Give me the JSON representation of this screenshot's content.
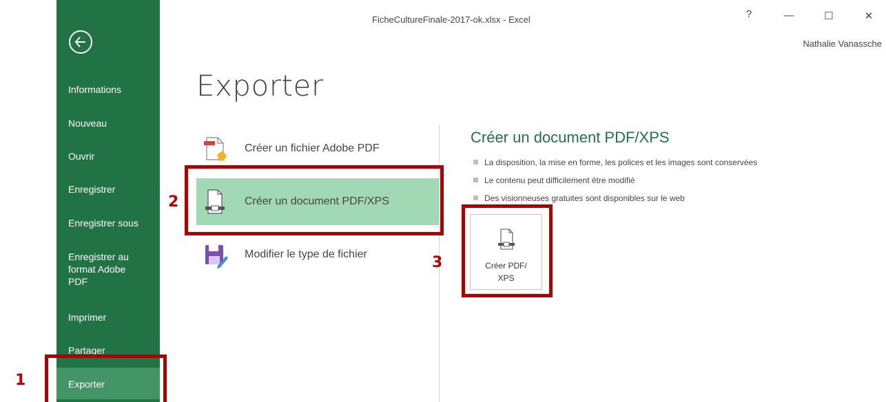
{
  "window": {
    "title": "FicheCultureFinale-2017-ok.xlsx - Excel",
    "user": "Nathalie Vanassche",
    "help_label": "?",
    "minimize_label": "—",
    "maximize_label": "☐",
    "close_label": "✕"
  },
  "sidebar": {
    "back_icon": "back-arrow-circle-icon",
    "items": [
      {
        "label": "Informations"
      },
      {
        "label": "Nouveau"
      },
      {
        "label": "Ouvrir"
      },
      {
        "label": "Enregistrer"
      },
      {
        "label": "Enregistrer sous"
      },
      {
        "label": "Enregistrer au format Adobe PDF"
      },
      {
        "label": "Imprimer"
      },
      {
        "label": "Partager"
      },
      {
        "label": "Exporter"
      }
    ],
    "active_item": "Exporter"
  },
  "main": {
    "title": "Exporter",
    "options": [
      {
        "label": "Créer un fichier Adobe PDF",
        "icon": "adobe-pdf-icon"
      },
      {
        "label": "Créer un document PDF/XPS",
        "icon": "pdf-xps-document-icon",
        "selected": true
      },
      {
        "label": "Modifier le type de fichier",
        "icon": "change-file-type-icon"
      }
    ]
  },
  "detail": {
    "title": "Créer un document PDF/XPS",
    "bullets": [
      "La disposition, la mise en forme, les polices et les images sont conservées",
      "Le contenu peut difficilement être modifié",
      "Des visionneuses gratuites sont disponibles sur le web"
    ],
    "button_label_line1": "Créer PDF/",
    "button_label_line2": "XPS"
  },
  "annotations": {
    "step1": "1",
    "step2": "2",
    "step3": "3",
    "highlight_color": "#b00000"
  },
  "colors": {
    "sidebar_bg": "#217346",
    "sidebar_active": "#439467",
    "selected_option": "#a0d9b4",
    "accent_text": "#217346"
  }
}
